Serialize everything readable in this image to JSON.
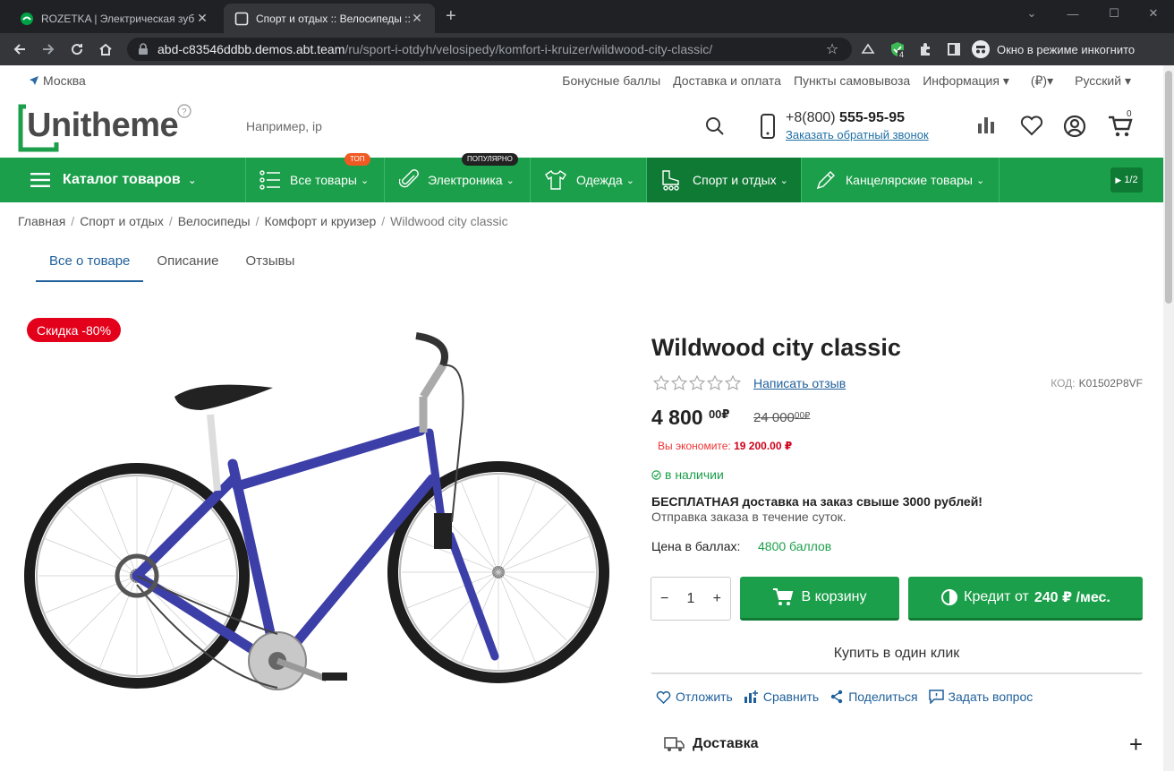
{
  "browser": {
    "tabs": [
      {
        "title": "ROZETKA | Электрическая зубная",
        "active": false
      },
      {
        "title": "Спорт и отдых :: Велосипеды :: К",
        "active": true
      }
    ],
    "url_host": "abd-c83546ddbb.demos.abt.team",
    "url_path": "/ru/sport-i-otdyh/velosipedy/komfort-i-kruizer/wildwood-city-classic/",
    "incognito_label": "Окно в режиме инкогнито",
    "extension_badge": "4"
  },
  "topline": {
    "city": "Москва",
    "links": [
      "Бонусные баллы",
      "Доставка и оплата",
      "Пункты самовывоза",
      "Информация ▾",
      "(₽)▾",
      "Русский ▾"
    ]
  },
  "header": {
    "logo": "Unitheme",
    "search_placeholder": "Например, ip",
    "phone_prefix": "+8(800)",
    "phone_number": "555-95-95",
    "callback": "Заказать обратный звонок",
    "cart_count": "0"
  },
  "catalog": {
    "label": "Каталог товаров",
    "items": [
      {
        "label": "Все товары",
        "badge": "топ"
      },
      {
        "label": "Электроника",
        "badge": "популярно"
      },
      {
        "label": "Одежда",
        "badge": ""
      },
      {
        "label": "Спорт и отдых",
        "badge": ""
      },
      {
        "label": "Канцелярские товары",
        "badge": ""
      }
    ],
    "pager": "1/2"
  },
  "breadcrumb": [
    "Главная",
    "Спорт и отдых",
    "Велосипеды",
    "Комфорт и круизер",
    "Wildwood city classic"
  ],
  "tabs": [
    "Все о товаре",
    "Описание",
    "Отзывы"
  ],
  "product": {
    "discount": "Скидка -80%",
    "title": "Wildwood city classic",
    "review_link": "Написать отзыв",
    "sku_label": "КОД:",
    "sku": "K01502P8VF",
    "price_main": "4 800",
    "price_cents": "00",
    "currency": "₽",
    "old_price_main": "24 000",
    "old_price_cents": "00",
    "save_label": "Вы экономите:",
    "save_value": "19 200.00 ₽",
    "stock": "в наличии",
    "delivery_bold": "БЕСПЛАТНАЯ",
    "delivery_rest": " доставка на заказ свыше 3000 рублей!",
    "ship_note": "Отправка заказа в течение суток.",
    "points_label": "Цена в баллах:",
    "points_value": "4800 баллов",
    "qty": "1",
    "add_to_cart": "В корзину",
    "credit_prefix": "Кредит от",
    "credit_value": "240 ₽ /мес.",
    "one_click": "Купить в один клик",
    "actions": [
      "Отложить",
      "Сравнить",
      "Поделиться",
      "Задать вопрос"
    ],
    "delivery_section": "Доставка",
    "rating": 0
  },
  "colors": {
    "brand_green": "#1b9f4a",
    "dark_green": "#0e7a34",
    "discount_red": "#e3001b",
    "link_blue": "#1f5f9a"
  }
}
